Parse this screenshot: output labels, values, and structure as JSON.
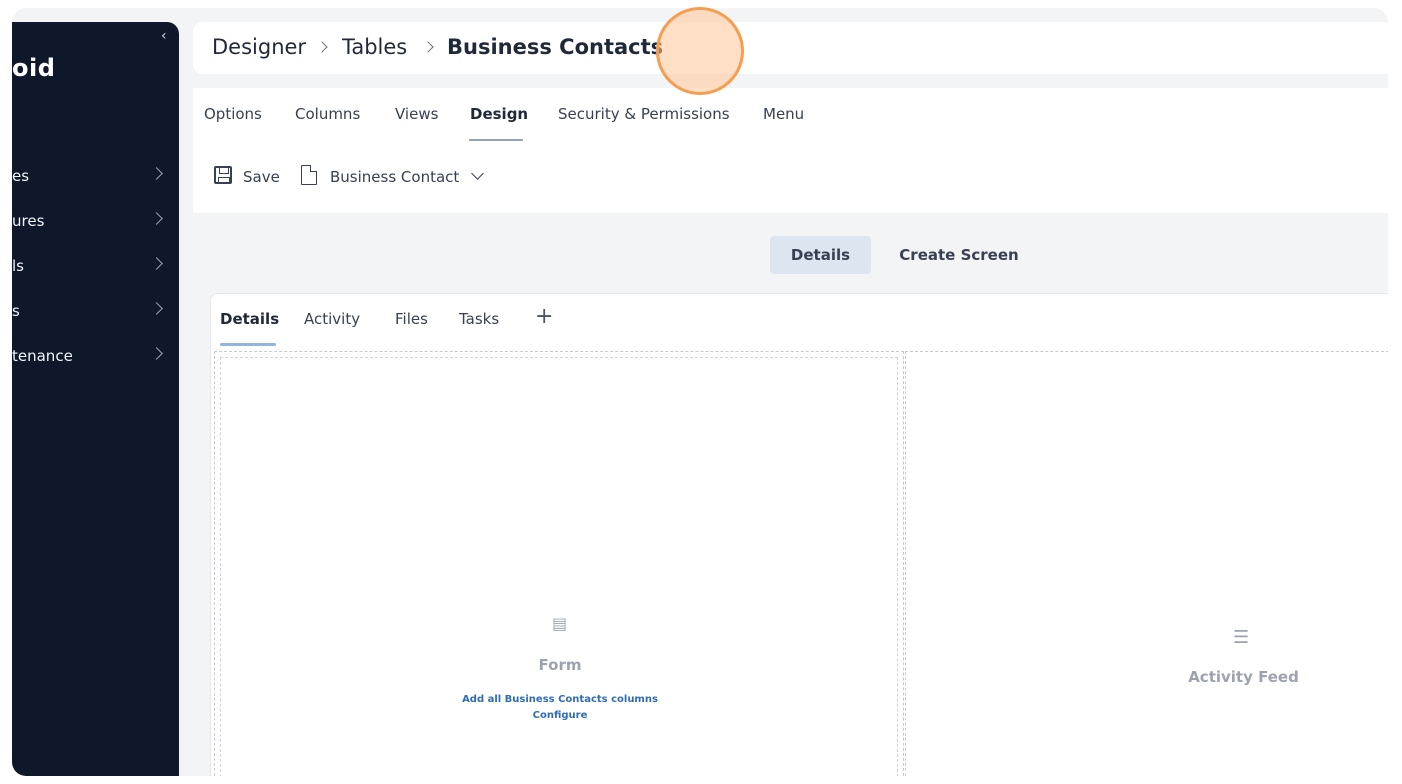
{
  "sidebar": {
    "logo": "oid",
    "collapse_icon": "chevron-left-icon",
    "items": [
      {
        "label": "es"
      },
      {
        "label": "ures"
      },
      {
        "label": "ls"
      },
      {
        "label": "s"
      },
      {
        "label": "tenance"
      }
    ]
  },
  "breadcrumb": {
    "items": [
      "Designer",
      "Tables",
      "Business Contacts"
    ]
  },
  "tabs": [
    "Options",
    "Columns",
    "Views",
    "Design",
    "Security & Permissions",
    "Menu"
  ],
  "active_tab": "Design",
  "toolbar": {
    "save_label": "Save",
    "form_select_label": "Business Contact"
  },
  "segments": [
    "Details",
    "Create Screen"
  ],
  "active_segment": "Details",
  "screen_tabs": [
    "Details",
    "Activity",
    "Files",
    "Tasks"
  ],
  "active_screen_tab": "Details",
  "zones": {
    "form": {
      "title": "Form",
      "link_add": "Add all Business Contacts columns",
      "link_configure": "Configure"
    },
    "activity": {
      "title": "Activity Feed"
    }
  },
  "colors": {
    "sidebar": "#0f172a",
    "accent": "#2f6db3",
    "click_indicator": "#f59e4f"
  }
}
